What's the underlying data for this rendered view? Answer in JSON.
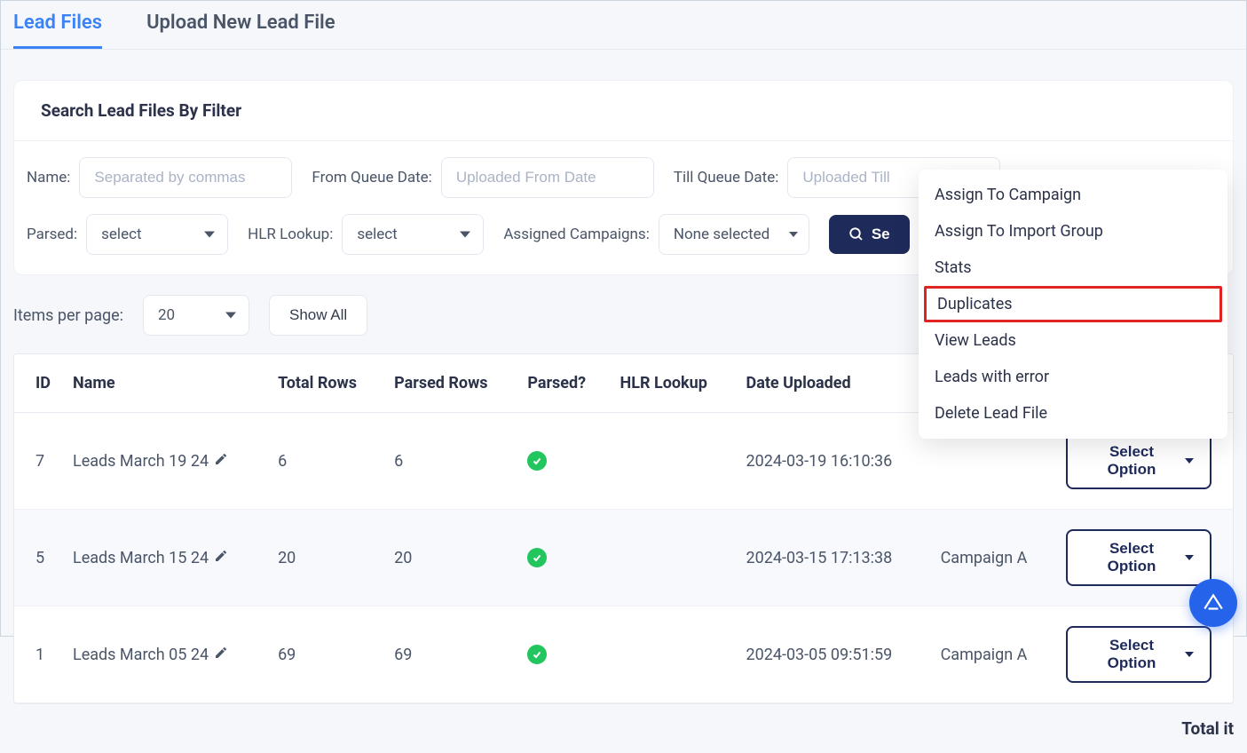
{
  "tabs": {
    "lead_files": "Lead Files",
    "upload_new": "Upload New Lead File"
  },
  "filter_card": {
    "title": "Search Lead Files By Filter",
    "name_label": "Name:",
    "name_placeholder": "Separated by commas",
    "from_date_label": "From Queue Date:",
    "from_date_placeholder": "Uploaded From Date",
    "till_date_label": "Till Queue Date:",
    "till_date_placeholder": "Uploaded Till",
    "parsed_label": "Parsed:",
    "parsed_value": "select",
    "hlr_label": "HLR Lookup:",
    "hlr_value": "select",
    "campaigns_label": "Assigned Campaigns:",
    "campaigns_value": "None selected",
    "search_button": "Se"
  },
  "items_bar": {
    "label": "Items per page:",
    "per_page": "20",
    "show_all": "Show All"
  },
  "table": {
    "headers": {
      "id": "ID",
      "name": "Name",
      "total_rows": "Total Rows",
      "parsed_rows": "Parsed Rows",
      "parsed": "Parsed?",
      "hlr": "HLR Lookup",
      "date": "Date Uploaded",
      "campaigns": "",
      "action": ""
    },
    "rows": [
      {
        "id": "7",
        "name": "Leads March 19 24",
        "total": "6",
        "parsed_rows": "6",
        "parsed": true,
        "hlr": "",
        "date": "2024-03-19 16:10:36",
        "campaigns": "",
        "action": "Select Option"
      },
      {
        "id": "5",
        "name": "Leads March 15 24",
        "total": "20",
        "parsed_rows": "20",
        "parsed": true,
        "hlr": "",
        "date": "2024-03-15 17:13:38",
        "campaigns": "Campaign A",
        "action": "Select Option"
      },
      {
        "id": "1",
        "name": "Leads March 05 24",
        "total": "69",
        "parsed_rows": "69",
        "parsed": true,
        "hlr": "",
        "date": "2024-03-05 09:51:59",
        "campaigns": "Campaign A",
        "action": "Select Option"
      }
    ],
    "total_label": "Total it"
  },
  "dropdown": {
    "items": [
      "Assign To Campaign",
      "Assign To Import Group",
      "Stats",
      "Duplicates",
      "View Leads",
      "Leads with error",
      "Delete Lead File"
    ],
    "highlight_index": 3
  }
}
